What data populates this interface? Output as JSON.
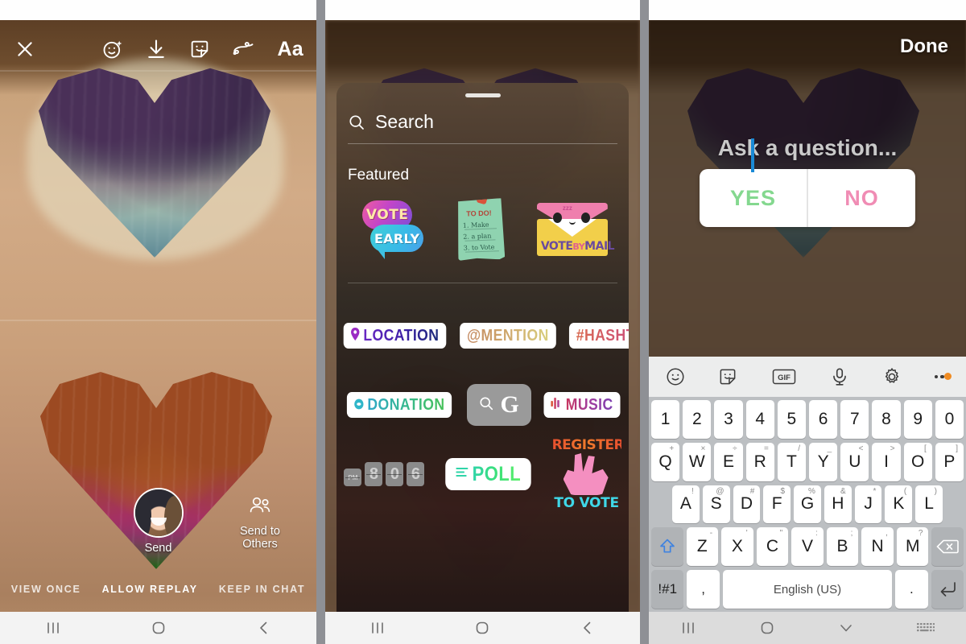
{
  "panel1": {
    "name": "story-editor",
    "toolbar": {
      "close_label": "close-icon",
      "items": [
        {
          "name": "effects-icon",
          "label": "Effects"
        },
        {
          "name": "download-icon",
          "label": "Save"
        },
        {
          "name": "sticker-icon",
          "label": "Stickers"
        },
        {
          "name": "draw-icon",
          "label": "Draw"
        },
        {
          "name": "text-icon",
          "label": "Aa"
        }
      ],
      "text_label": "Aa"
    },
    "send": {
      "self_label": "Send",
      "others_label": "Send to Others"
    },
    "replay_options": [
      {
        "label": "VIEW ONCE",
        "active": false
      },
      {
        "label": "ALLOW REPLAY",
        "active": true
      },
      {
        "label": "KEEP IN CHAT",
        "active": false
      }
    ]
  },
  "panel2": {
    "name": "sticker-tray",
    "search": {
      "placeholder": "Search",
      "value": "Search"
    },
    "section_title": "Featured",
    "featured": [
      {
        "name": "vote-early-sticker",
        "line1": "VOTE",
        "line2": "EARLY"
      },
      {
        "name": "to-do-vote-sticker",
        "heading": "TO DO!",
        "items": [
          "1. Make",
          "2. a plan",
          "3. to Vote"
        ]
      },
      {
        "name": "vote-by-mail-sticker",
        "text": "VOTE",
        "text2": "BY",
        "text3": "MAIL",
        "zzz": "zzz"
      }
    ],
    "stickers": [
      {
        "name": "location-sticker",
        "label": "LOCATION",
        "icon": "pin-icon"
      },
      {
        "name": "mention-sticker",
        "label": "@MENTION",
        "icon": ""
      },
      {
        "name": "hashtag-sticker",
        "label": "#HASHTAG",
        "icon": ""
      },
      {
        "name": "donation-sticker",
        "label": "DONATION",
        "icon": "donate-icon"
      },
      {
        "name": "gif-search-sticker",
        "label": "G",
        "icon": "search-icon"
      },
      {
        "name": "music-sticker",
        "label": "MUSIC",
        "icon": "equalizer-icon"
      },
      {
        "name": "countdown-sticker",
        "label": "",
        "digits": [
          "8",
          "0",
          "6"
        ],
        "unit": "PM"
      },
      {
        "name": "poll-sticker",
        "label": "POLL",
        "icon": "poll-icon"
      },
      {
        "name": "register-to-vote-sticker",
        "line1": "REGISTER",
        "line2": "TO VOTE"
      }
    ]
  },
  "panel3": {
    "name": "question-sticker-editor",
    "done_label": "Done",
    "question": {
      "placeholder": "Ask a question...",
      "value": "Ask a question...",
      "yes_label": "YES",
      "no_label": "NO"
    },
    "keyboard_toolbar": [
      {
        "name": "emoji-icon"
      },
      {
        "name": "sticker-icon"
      },
      {
        "name": "gif-icon",
        "label": "GIF"
      },
      {
        "name": "microphone-icon"
      },
      {
        "name": "settings-gear-icon"
      },
      {
        "name": "more-options-icon"
      }
    ],
    "keyboard": {
      "row1": [
        {
          "key": "1"
        },
        {
          "key": "2"
        },
        {
          "key": "3"
        },
        {
          "key": "4"
        },
        {
          "key": "5"
        },
        {
          "key": "6"
        },
        {
          "key": "7"
        },
        {
          "key": "8"
        },
        {
          "key": "9"
        },
        {
          "key": "0"
        }
      ],
      "row2": [
        {
          "key": "Q",
          "sup": "+"
        },
        {
          "key": "W",
          "sup": "×"
        },
        {
          "key": "E",
          "sup": "÷"
        },
        {
          "key": "R",
          "sup": "="
        },
        {
          "key": "T",
          "sup": "/"
        },
        {
          "key": "Y",
          "sup": "_"
        },
        {
          "key": "U",
          "sup": "<"
        },
        {
          "key": "I",
          "sup": ">"
        },
        {
          "key": "O",
          "sup": "["
        },
        {
          "key": "P",
          "sup": "]"
        }
      ],
      "row3": [
        {
          "key": "A",
          "sup": "!"
        },
        {
          "key": "S",
          "sup": "@"
        },
        {
          "key": "D",
          "sup": "#"
        },
        {
          "key": "F",
          "sup": "$"
        },
        {
          "key": "G",
          "sup": "%"
        },
        {
          "key": "H",
          "sup": "&"
        },
        {
          "key": "J",
          "sup": "*"
        },
        {
          "key": "K",
          "sup": "("
        },
        {
          "key": "L",
          "sup": ")"
        }
      ],
      "row4": [
        {
          "key": "Z",
          "sup": "-"
        },
        {
          "key": "X",
          "sup": "'"
        },
        {
          "key": "C",
          "sup": "\""
        },
        {
          "key": "V",
          "sup": ":"
        },
        {
          "key": "B",
          "sup": ";"
        },
        {
          "key": "N",
          "sup": ","
        },
        {
          "key": "M",
          "sup": "?"
        }
      ],
      "shift_label": "shift-icon",
      "backspace_label": "backspace-icon",
      "symbols_label": "!#1",
      "comma_label": ",",
      "space_label": "English (US)",
      "period_label": ".",
      "enter_label": "enter-icon"
    }
  },
  "navbar": {
    "recents_label": "recents-icon",
    "home_label": "home-icon",
    "back_label": "back-icon",
    "hide_keyboard_label": "chevron-down-icon",
    "keyboard_switch_label": "keyboard-icon"
  },
  "colors": {
    "divider": "#8e9095",
    "accent_blue": "#1a8ad6",
    "yes_green": "#84d88f",
    "no_pink": "#f08cb4",
    "badge_orange": "#ef8b22",
    "keyboard_bg": "#bcbfc2"
  }
}
